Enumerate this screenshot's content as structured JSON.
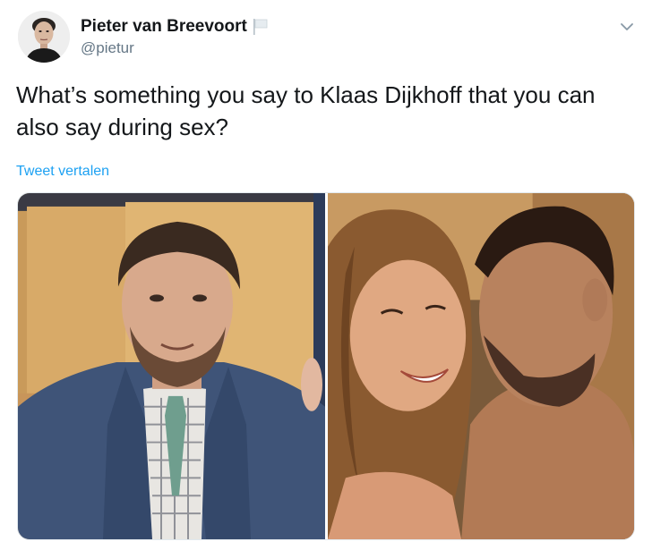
{
  "author": {
    "display_name": "Pieter van Breevoort",
    "handle": "@pietur"
  },
  "icons": {
    "flag": "flag-icon",
    "menu": "chevron-down-icon"
  },
  "tweet": {
    "text": "What’s something you say to Klaas Dijkhoff that you can also say during sex?",
    "translate_label": "Tweet vertalen"
  },
  "colors": {
    "link": "#1da1f2",
    "secondary_text": "#657786",
    "primary_text": "#14171a"
  }
}
